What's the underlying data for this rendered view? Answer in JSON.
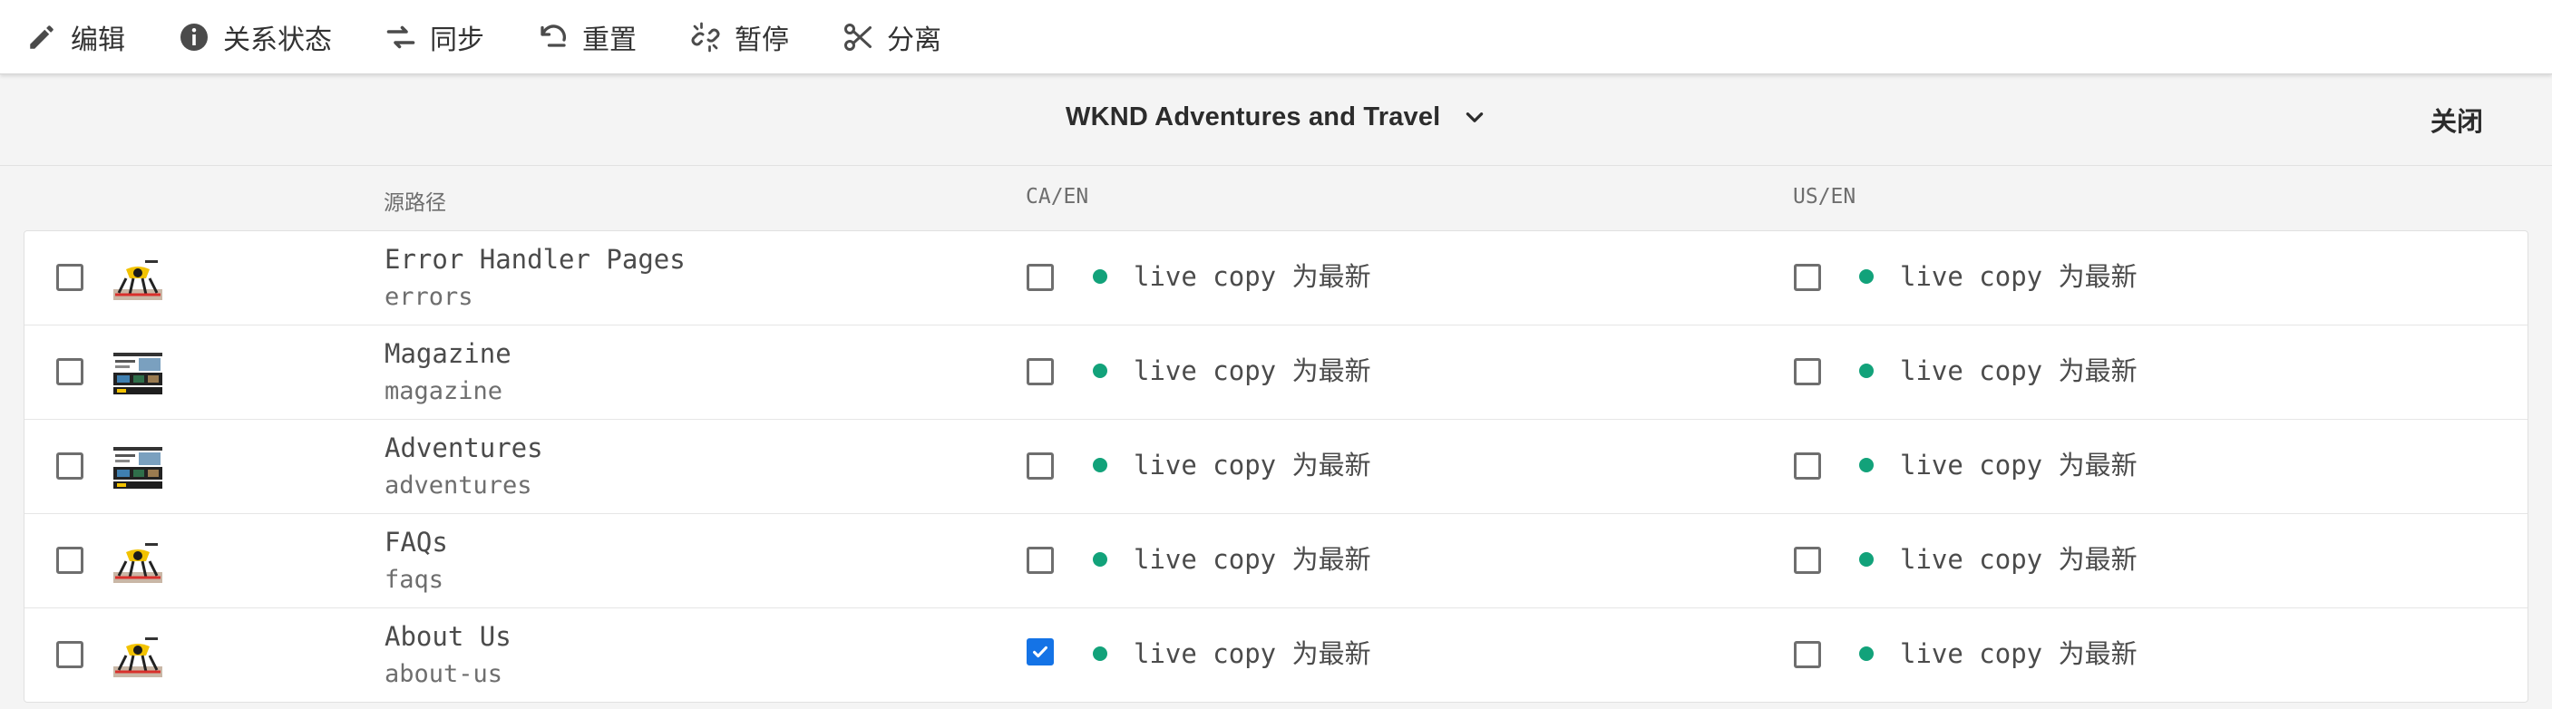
{
  "toolbar": {
    "items": [
      {
        "label": "编辑",
        "icon": "pencil-icon"
      },
      {
        "label": "关系状态",
        "icon": "info-icon"
      },
      {
        "label": "同步",
        "icon": "sync-arrows-icon"
      },
      {
        "label": "重置",
        "icon": "undo-icon"
      },
      {
        "label": "暂停",
        "icon": "broken-link-icon"
      },
      {
        "label": "分离",
        "icon": "scissors-icon"
      }
    ]
  },
  "header": {
    "site_title": "WKND Adventures and Travel",
    "close_label": "关闭"
  },
  "columns": {
    "source": "源路径",
    "ca_en": "CA/EN",
    "us_en": "US/EN"
  },
  "rows": [
    {
      "title": "Error Handler Pages",
      "path": "errors",
      "ca_status": "live copy 为最新",
      "us_status": "live copy 为最新",
      "ca_checked": false
    },
    {
      "title": "Magazine",
      "path": "magazine",
      "ca_status": "live copy 为最新",
      "us_status": "live copy 为最新",
      "ca_checked": false
    },
    {
      "title": "Adventures",
      "path": "adventures",
      "ca_status": "live copy 为最新",
      "us_status": "live copy 为最新",
      "ca_checked": false
    },
    {
      "title": "FAQs",
      "path": "faqs",
      "ca_status": "live copy 为最新",
      "us_status": "live copy 为最新",
      "ca_checked": false
    },
    {
      "title": "About Us",
      "path": "about-us",
      "ca_status": "live copy 为最新",
      "us_status": "live copy 为最新",
      "ca_checked": true
    }
  ],
  "colors": {
    "status_ok": "#12a27a",
    "checked_blue": "#1473e6"
  }
}
